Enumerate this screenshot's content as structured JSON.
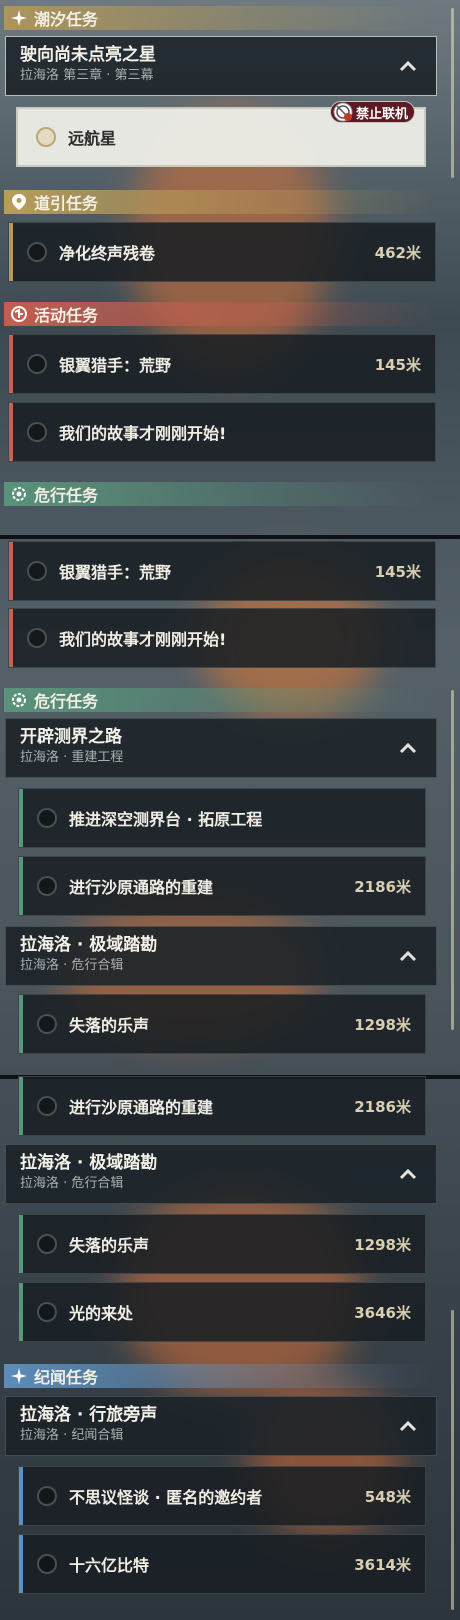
{
  "headers": {
    "tide": "潮汐任务",
    "guide": "道引任务",
    "event": "活动任务",
    "danger": "危行任务",
    "lore": "纪闻任务"
  },
  "tide_group": {
    "title": "驶向尚未点亮之星",
    "subtitle": "拉海洛 第三章 · 第三幕"
  },
  "tide_item": {
    "name": "远航星",
    "badge": "禁止联机"
  },
  "guide_item": {
    "name": "净化终声残卷",
    "dist": "462米"
  },
  "event_items": [
    {
      "name": "银翼猎手：荒野",
      "dist": "145米"
    },
    {
      "name": "我们的故事才刚刚开始!",
      "dist": ""
    }
  ],
  "danger_groups": [
    {
      "title": "开辟测界之路",
      "subtitle": "拉海洛 · 重建工程",
      "items": [
        {
          "name": "推进深空测界台 · 拓原工程",
          "dist": ""
        },
        {
          "name": "进行沙原通路的重建",
          "dist": "2186米"
        }
      ]
    },
    {
      "title": "拉海洛 · 极域踏勘",
      "subtitle": "拉海洛 · 危行合辑",
      "items": [
        {
          "name": "失落的乐声",
          "dist": "1298米"
        },
        {
          "name": "光的来处",
          "dist": "3646米"
        }
      ]
    }
  ],
  "lore_group": {
    "title": "拉海洛 · 行旅旁声",
    "subtitle": "拉海洛 · 纪闻合辑",
    "items": [
      {
        "name": "不思议怪谈 · 匿名的邀约者",
        "dist": "548米"
      },
      {
        "name": "十六亿比特",
        "dist": "3614米"
      }
    ]
  },
  "colors": {
    "tide": "#b0965a",
    "guide": "#bea05a",
    "event": "#cd5f50",
    "danger": "#5a967d",
    "lore": "#5f91be"
  }
}
